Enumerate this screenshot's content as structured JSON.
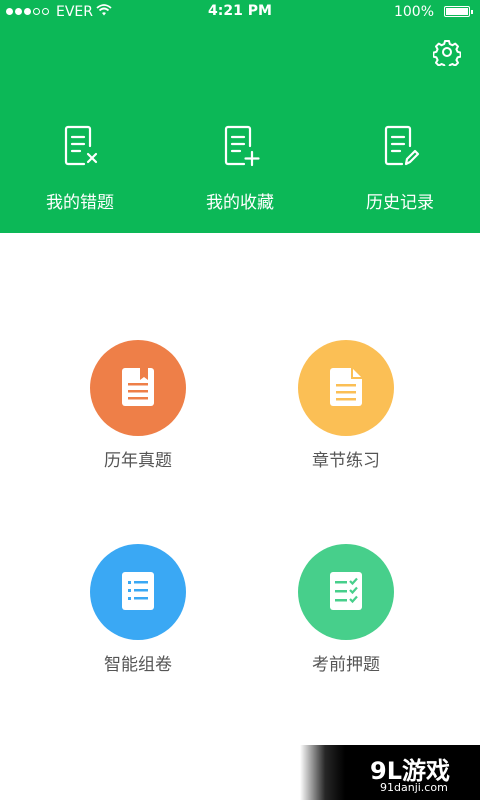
{
  "status_bar": {
    "carrier": "EVER",
    "time": "4:21 PM",
    "battery": "100%"
  },
  "header": {
    "items": [
      {
        "label": "我的错题",
        "icon": "wrong-questions-icon"
      },
      {
        "label": "我的收藏",
        "icon": "favorites-icon"
      },
      {
        "label": "历史记录",
        "icon": "history-icon"
      }
    ],
    "settings_icon": "gear-icon"
  },
  "grid": [
    {
      "label": "历年真题",
      "icon": "past-exams-icon",
      "color": "#ee7f48"
    },
    {
      "label": "章节练习",
      "icon": "chapter-practice-icon",
      "color": "#fbbf55"
    },
    {
      "label": "智能组卷",
      "icon": "smart-paper-icon",
      "color": "#3aa8f4"
    },
    {
      "label": "考前押题",
      "icon": "pre-exam-predictions-icon",
      "color": "#47cf8b"
    }
  ],
  "colors": {
    "header_bg": "#0cb857",
    "label_text": "#555555"
  },
  "watermark": {
    "logo": "9L游戏",
    "url": "91danji.com"
  }
}
